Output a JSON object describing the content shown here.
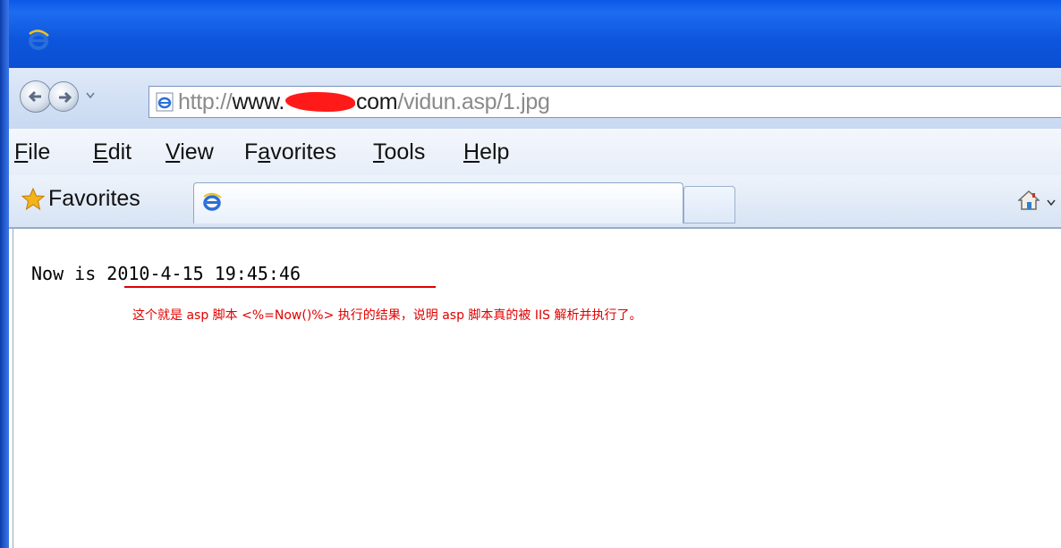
{
  "browser": {
    "address": {
      "url_prefix": "http://",
      "url_host_start": "www.",
      "url_host_end": "com",
      "url_path": "/vidun.asp/1.jpg"
    },
    "menu": [
      {
        "label": "File",
        "key": "F"
      },
      {
        "label": "Edit",
        "key": "E"
      },
      {
        "label": "View",
        "key": "V"
      },
      {
        "label": "Favorites",
        "key": "a"
      },
      {
        "label": "Tools",
        "key": "T"
      },
      {
        "label": "Help",
        "key": "H"
      }
    ],
    "favorites_label": "Favorites"
  },
  "page": {
    "now_text": "Now is 2010-4-15 19:45:46",
    "annotation": "这个就是 asp 脚本 <%=Now()%> 执行的结果，说明 asp 脚本真的被 IIS 解析并执行了。"
  },
  "colors": {
    "annotation": "#e00000",
    "titlebar": "#0a58e8"
  },
  "icons": {
    "title": "ie-logo-icon",
    "back": "back-arrow-icon",
    "forward": "forward-arrow-icon",
    "favorites": "star-icon",
    "home": "home-icon"
  }
}
